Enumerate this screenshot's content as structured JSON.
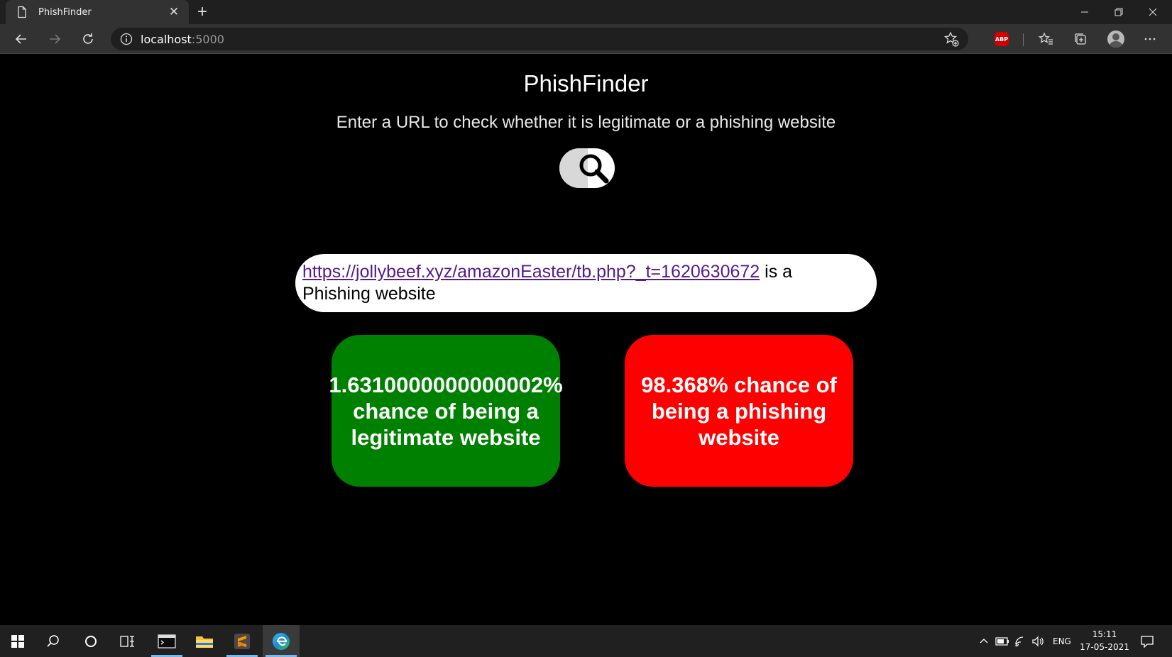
{
  "browser": {
    "tab_title": "PhishFinder",
    "tab_close": "✕",
    "new_tab": "+",
    "url_host": "localhost",
    "url_port": ":5000",
    "abp_label": "ABP"
  },
  "page": {
    "title": "PhishFinder",
    "subtitle": "Enter a URL to check whether it is legitimate or a phishing website",
    "result": {
      "url": "https://jollybeef.xyz/amazonEaster/tb.php?_t=1620630672",
      "verdict_text": " is a Phishing website"
    },
    "legit_card": {
      "text": "1.6310000000000002% chance of being a legitimate website",
      "color": "#008000"
    },
    "phish_card": {
      "text": "98.368% chance of being a phishing website",
      "color": "#ff0000"
    }
  },
  "taskbar": {
    "language": "ENG",
    "time": "15:11",
    "date": "17-05-2021"
  }
}
